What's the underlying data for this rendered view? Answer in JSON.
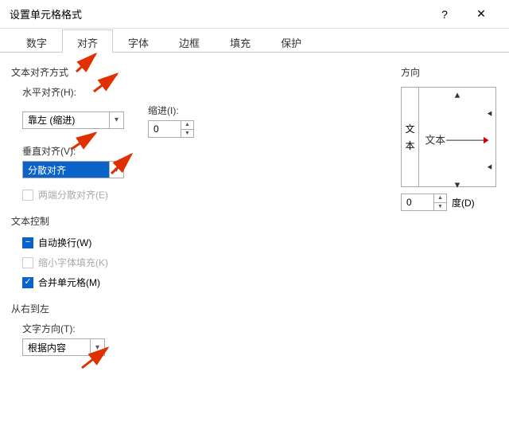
{
  "window": {
    "title": "设置单元格格式"
  },
  "tabs": [
    {
      "label": "数字"
    },
    {
      "label": "对齐",
      "active": true
    },
    {
      "label": "字体"
    },
    {
      "label": "边框"
    },
    {
      "label": "填充"
    },
    {
      "label": "保护"
    }
  ],
  "align": {
    "section": "文本对齐方式",
    "h_label": "水平对齐(H):",
    "h_value": "靠左 (缩进)",
    "indent_label": "缩进(I):",
    "indent_value": "0",
    "v_label": "垂直对齐(V):",
    "v_value": "分散对齐",
    "justify_distributed": "两端分散对齐(E)"
  },
  "textctrl": {
    "section": "文本控制",
    "wrap": "自动换行(W)",
    "shrink": "缩小字体填充(K)",
    "merge": "合并单元格(M)"
  },
  "rtl": {
    "section": "从右到左",
    "dir_label": "文字方向(T):",
    "dir_value": "根据内容"
  },
  "orient": {
    "section": "方向",
    "v_text1": "文",
    "v_text2": "本",
    "center_text": "文本",
    "deg_value": "0",
    "deg_label": "度(D)"
  }
}
